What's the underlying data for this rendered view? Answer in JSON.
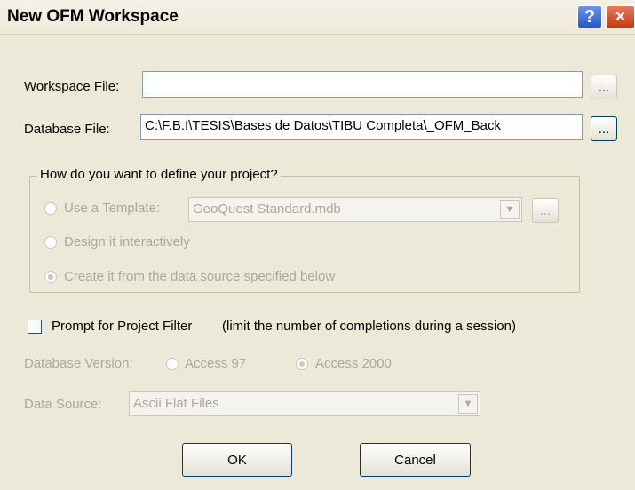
{
  "window": {
    "title": "New OFM Workspace",
    "help_icon": "?",
    "close_icon": "×"
  },
  "workspace_file": {
    "label": "Workspace File:",
    "value": "",
    "browse_label": "..."
  },
  "database_file": {
    "label": "Database File:",
    "value": "C:\\F.B.I\\TESIS\\Bases de Datos\\TIBU Completa\\_OFM_Back",
    "browse_label": "..."
  },
  "project_group": {
    "legend": "How do you want to define your project?",
    "use_template_label": "Use a Template:",
    "template_value": "GeoQuest Standard.mdb",
    "template_browse_label": "...",
    "design_label": "Design it interactively",
    "create_label": "Create it from the data source specified below",
    "selected": "create"
  },
  "prompt_filter": {
    "label": "Prompt for Project Filter",
    "hint": "(limit the number of completions during a session)",
    "checked": false
  },
  "database_version": {
    "label": "Database Version:",
    "option_97": "Access 97",
    "option_2000": "Access 2000",
    "selected": "2000"
  },
  "data_source": {
    "label": "Data Source:",
    "value": "Ascii Flat Files"
  },
  "buttons": {
    "ok": "OK",
    "cancel": "Cancel"
  },
  "colors": {
    "dialog_bg": "#ece9d8",
    "disabled_text": "#aca899",
    "help_button": "#2558c9",
    "close_button": "#c23a15"
  }
}
